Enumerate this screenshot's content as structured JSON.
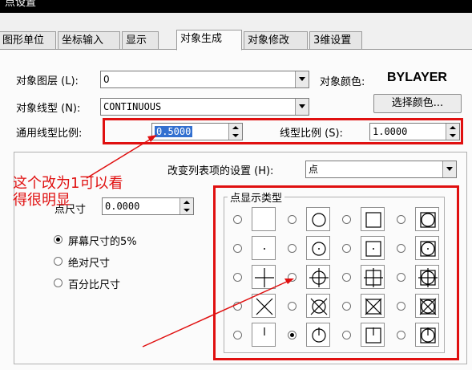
{
  "window": {
    "title": "点设置"
  },
  "tabs": [
    {
      "label": "图形单位"
    },
    {
      "label": "坐标输入"
    },
    {
      "label": "显示"
    },
    {
      "label": "对象生成"
    },
    {
      "label": "对象修改"
    },
    {
      "label": "3维设置"
    }
  ],
  "object_layer": {
    "label": "对象图层 (L):",
    "value": "0"
  },
  "object_color": {
    "label": "对象颜色:",
    "value": "BYLAYER",
    "button": "选择颜色..."
  },
  "object_linetype": {
    "label": "对象线型 (N):",
    "value": "CONTINUOUS"
  },
  "global_scale": {
    "label": "通用线型比例:",
    "value": "0.5000"
  },
  "linetype_scale": {
    "label": "线型比例 (S):",
    "value": "1.0000"
  },
  "list_setting": {
    "label": "改变列表项的设置 (H):",
    "value": "点"
  },
  "point_size": {
    "label": "点尺寸",
    "value": "0.0000"
  },
  "size_mode": [
    {
      "label": "屏幕尺寸的5%",
      "selected": true
    },
    {
      "label": "绝对尺寸",
      "selected": false
    },
    {
      "label": "百分比尺寸",
      "selected": false
    }
  ],
  "point_types": {
    "label": "点显示类型",
    "selected_index": 9,
    "symbols": [
      "none",
      "dot",
      "cross",
      "x",
      "tick",
      "circle",
      "circle-dot",
      "circle-cross",
      "circle-x",
      "circle-tick",
      "square",
      "square-dot",
      "square-cross",
      "square-x",
      "square-tick",
      "circle-square",
      "circle-square-dot",
      "circle-square-cross",
      "circle-square-x",
      "circle-square-tick"
    ]
  },
  "annotation": {
    "line1": "这个改为1可以看",
    "line2": "得很明显"
  },
  "colors": {
    "annotation_red": "#e01010",
    "selection_blue": "#3370d0"
  }
}
